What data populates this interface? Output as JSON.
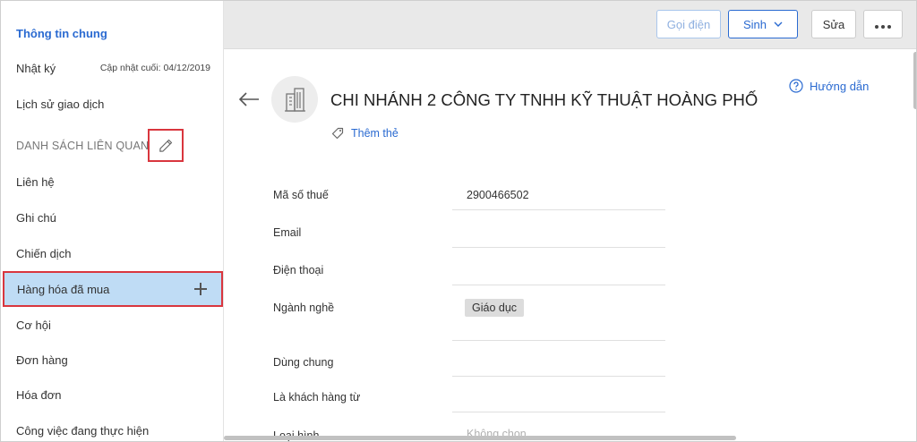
{
  "sidebar": {
    "general_info": "Thông tin chung",
    "log": {
      "label": "Nhật ký",
      "meta": "Cập nhật cuối: 04/12/2019"
    },
    "history": "Lịch sử giao dịch",
    "related_heading": "DANH SÁCH LIÊN QUAN",
    "items": [
      "Liên hệ",
      "Ghi chú",
      "Chiến dịch",
      "Hàng hóa đã mua",
      "Cơ hội",
      "Đơn hàng",
      "Hóa đơn",
      "Công việc đang thực hiện"
    ]
  },
  "toolbar": {
    "call_label": "Gọi điện",
    "generate_label": "Sinh",
    "edit_label": "Sửa"
  },
  "main": {
    "company_name": "CHI NHÁNH 2 CÔNG TY TNHH KỸ THUẬT HOÀNG PHỐ",
    "add_tag": "Thêm thẻ",
    "guide": "Hướng dẫn",
    "fields": {
      "tax_code": {
        "label": "Mã số thuế",
        "value": "2900466502"
      },
      "email": {
        "label": "Email",
        "value": ""
      },
      "phone": {
        "label": "Điện thoại",
        "value": ""
      },
      "industry": {
        "label": "Ngành nghề",
        "value": "Giáo dục"
      },
      "shared": {
        "label": "Dùng chung",
        "value": ""
      },
      "customer_since": {
        "label": "Là khách hàng từ",
        "value": ""
      },
      "type": {
        "label": "Loại hình",
        "value": "Không chọn"
      }
    }
  },
  "colors": {
    "accent": "#2a6ad1",
    "highlight": "#d9363e",
    "active_bg": "#bfdcf5"
  }
}
